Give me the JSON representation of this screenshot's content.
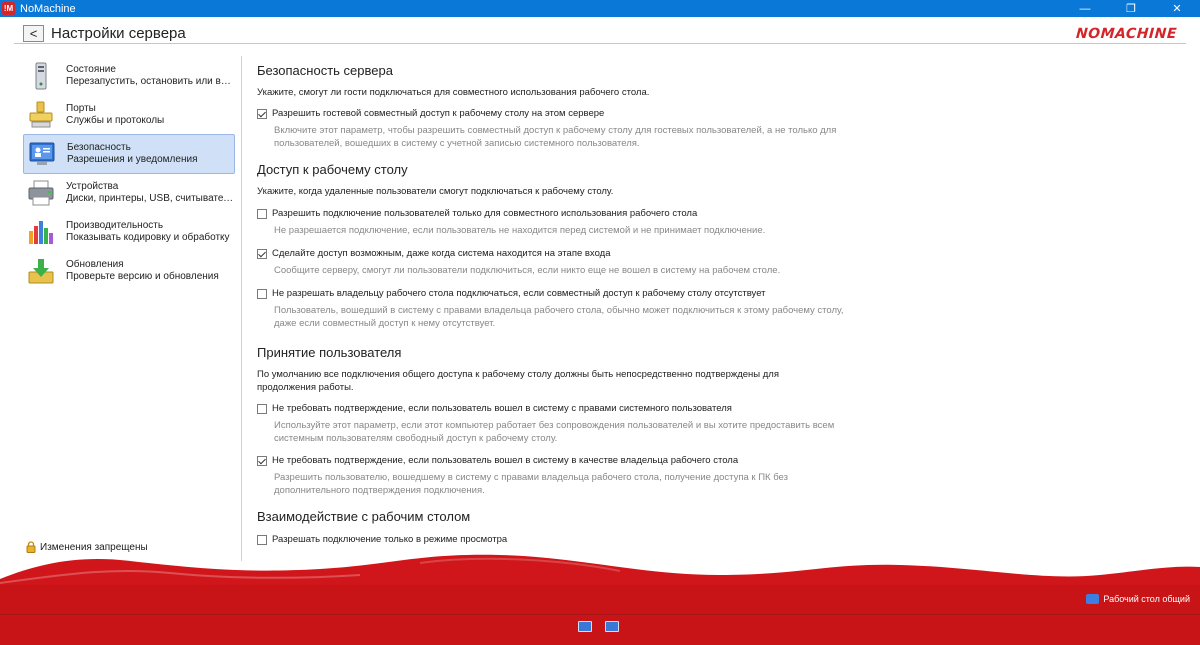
{
  "window": {
    "title": "NoMachine",
    "icon_text": "!M",
    "minimize_glyph": "—",
    "maximize_glyph": "❐",
    "close_glyph": "✕"
  },
  "header": {
    "back_glyph": "<",
    "title": "Настройки сервера",
    "brand": "NOMACHINE"
  },
  "sidebar": {
    "items": [
      {
        "title": "Состояние",
        "subtitle": "Перезапустить, остановить или выкл...",
        "icon": "server-status-icon"
      },
      {
        "title": "Порты",
        "subtitle": "Службы и протоколы",
        "icon": "ports-icon"
      },
      {
        "title": "Безопасность",
        "subtitle": "Разрешения и уведомления",
        "icon": "security-icon"
      },
      {
        "title": "Устройства",
        "subtitle": "Диски, принтеры, USB, считыватели с...",
        "icon": "printer-icon"
      },
      {
        "title": "Производительность",
        "subtitle": "Показывать кодировку и обработку",
        "icon": "performance-icon"
      },
      {
        "title": "Обновления",
        "subtitle": "Проверьте версию и обновления",
        "icon": "updates-icon"
      }
    ],
    "active_index": 2,
    "lock_label": "Изменения запрещены"
  },
  "main": {
    "sections": [
      {
        "heading": "Безопасность сервера",
        "description": "Укажите, смогут ли гости подключаться для совместного использования рабочего стола.",
        "options": [
          {
            "label": "Разрешить гостевой совместный доступ к рабочему столу на этом сервере",
            "checked": true,
            "hint": "Включите этот параметр, чтобы разрешить совместный доступ к рабочему столу для гостевых пользователей, а не только для пользователей, вошедших в систему с учетной записью системного пользователя."
          }
        ]
      },
      {
        "heading": "Доступ к рабочему столу",
        "description": "Укажите, когда удаленные пользователи смогут подключаться к рабочему столу.",
        "options": [
          {
            "label": "Разрешить подключение пользователей только для совместного использования рабочего стола",
            "checked": false,
            "hint": "Не разрешается подключение, если пользователь не находится перед системой и не принимает подключение."
          },
          {
            "label": "Сделайте доступ возможным, даже когда система находится на этапе входа",
            "checked": true,
            "hint": "Сообщите серверу, смогут ли пользователи подключиться, если никто еще не вошел в систему на рабочем столе."
          },
          {
            "label": "Не разрешать владельцу рабочего стола подключаться, если совместный доступ к рабочему столу отсутствует",
            "checked": false,
            "hint": "Пользователь, вошедший в систему с правами владельца рабочего стола, обычно может подключиться к этому рабочему столу, даже если совместный доступ к нему отсутствует."
          }
        ]
      },
      {
        "heading": "Принятие пользователя",
        "description": "По умолчанию все подключения общего доступа к рабочему столу должны быть непосредственно подтверждены для продолжения работы.",
        "options": [
          {
            "label": "Не требовать подтверждение, если пользователь вошел в систему с правами системного пользователя",
            "checked": false,
            "hint": "Используйте этот параметр, если этот компьютер работает без сопровождения пользователей и вы хотите предоставить всем системным пользователям свободный доступ к рабочему столу."
          },
          {
            "label": "Не требовать подтверждение, если пользователь вошел в систему в качестве владельца рабочего стола",
            "checked": true,
            "hint": "Разрешить пользователю, вошедшему в систему с правами владельца рабочего стола, получение доступа к ПК без дополнительного подтверждения подключения."
          }
        ]
      },
      {
        "heading": "Взаимодействие с рабочим столом",
        "description": "",
        "options": [
          {
            "label": "Разрешать подключение только в режиме просмотра",
            "checked": false,
            "hint": ""
          }
        ]
      }
    ]
  },
  "footer": {
    "share_status": "Рабочий стол общий",
    "colors": {
      "wave": "#d0161a",
      "dark": "#b81414"
    }
  }
}
